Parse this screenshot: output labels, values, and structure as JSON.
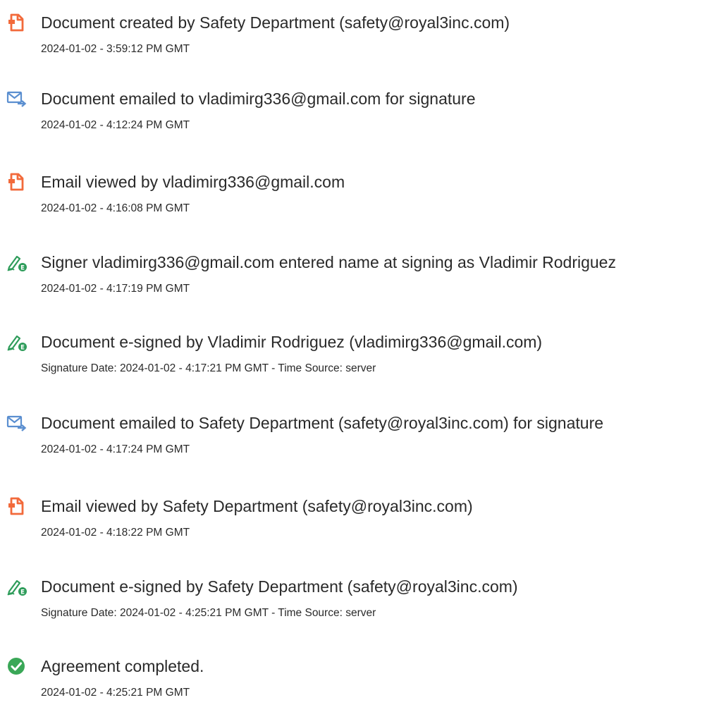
{
  "colors": {
    "doc_orange": "#f26a3b",
    "email_blue": "#5b8fd0",
    "sign_green": "#2e9c5a",
    "complete_green": "#3aa757",
    "text": "#2a2a2a"
  },
  "events": [
    {
      "icon": "document-icon",
      "title": "Document created by Safety Department (safety@royal3inc.com)",
      "meta": "2024-01-02 - 3:59:12 PM GMT"
    },
    {
      "icon": "email-icon",
      "title": "Document emailed to vladimirg336@gmail.com for signature",
      "meta": "2024-01-02 - 4:12:24 PM GMT"
    },
    {
      "icon": "document-icon",
      "title": "Email viewed by vladimirg336@gmail.com",
      "meta": "2024-01-02 - 4:16:08 PM GMT"
    },
    {
      "icon": "e-sign-icon",
      "title": "Signer vladimirg336@gmail.com entered name at signing as Vladimir Rodriguez",
      "meta": "2024-01-02 - 4:17:19 PM GMT"
    },
    {
      "icon": "e-sign-icon",
      "title": "Document e-signed by Vladimir Rodriguez (vladimirg336@gmail.com)",
      "meta": "Signature Date: 2024-01-02 - 4:17:21 PM GMT - Time Source: server"
    },
    {
      "icon": "email-icon",
      "title": "Document emailed to Safety Department (safety@royal3inc.com) for signature",
      "meta": "2024-01-02 - 4:17:24 PM GMT"
    },
    {
      "icon": "document-icon",
      "title": "Email viewed by Safety Department (safety@royal3inc.com)",
      "meta": "2024-01-02 - 4:18:22 PM GMT"
    },
    {
      "icon": "e-sign-icon",
      "title": "Document e-signed by Safety Department (safety@royal3inc.com)",
      "meta": "Signature Date: 2024-01-02 - 4:25:21 PM GMT - Time Source: server"
    },
    {
      "icon": "checkmark-circle-icon",
      "title": "Agreement completed.",
      "meta": "2024-01-02 - 4:25:21 PM GMT"
    }
  ]
}
